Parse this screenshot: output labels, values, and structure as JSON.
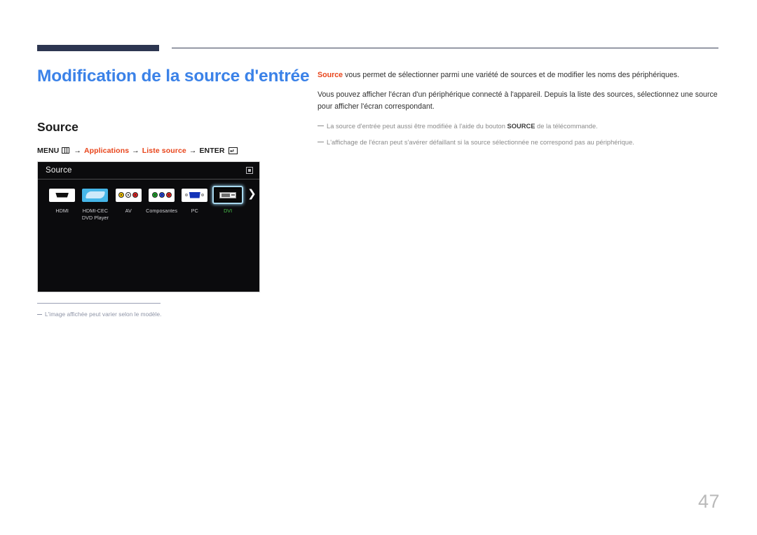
{
  "document": {
    "title": "Modification de la source d'entrée",
    "section_title": "Source",
    "page_number": "47",
    "title_color": "#3b82e8",
    "accent_color": "#e8441a",
    "rule_color": "#2d3651"
  },
  "menu_path": {
    "menu_label": "MENU",
    "menu_icon": "grid-icon",
    "arrow": "→",
    "step1": "Applications",
    "step2": "Liste source",
    "enter_label": "ENTER",
    "enter_icon": "enter-return-icon"
  },
  "tv_screen": {
    "title": "Source",
    "corner_icon": "return-box-icon",
    "next_icon": "chevron-right-icon",
    "sources": [
      {
        "label": "HDMI",
        "icon": "hdmi-connector-icon",
        "selected": false
      },
      {
        "label": "HDMI-CEC\nDVD Player",
        "icon": "hdmi-cec-icon",
        "selected": false
      },
      {
        "label": "AV",
        "icon": "av-rca-icon",
        "selected": false
      },
      {
        "label": "Composantes",
        "icon": "component-rca-icon",
        "selected": false
      },
      {
        "label": "PC",
        "icon": "vga-connector-icon",
        "selected": false
      },
      {
        "label": "DVI",
        "icon": "dvi-connector-icon",
        "selected": true
      }
    ],
    "selected_label_color": "#49c34b",
    "selection_border_color": "#a8d8ee"
  },
  "left_note": {
    "text": "L'image affichée peut varier selon le modèle."
  },
  "right_column": {
    "para1_accent": "Source",
    "para1_rest": " vous permet de sélectionner parmi une variété de sources et de modifier les noms des périphériques.",
    "para2": "Vous pouvez afficher l'écran d'un périphérique connecté à l'appareil. Depuis la liste des sources, sélectionnez une source pour afficher l'écran correspondant.",
    "note1_a": "La source d'entrée peut aussi être modifiée à l'aide du bouton ",
    "note1_b": "SOURCE",
    "note1_c": " de la télécommande.",
    "note2": "L'affichage de l'écran peut s'avérer défaillant si la source sélectionnée ne correspond pas au périphérique."
  }
}
